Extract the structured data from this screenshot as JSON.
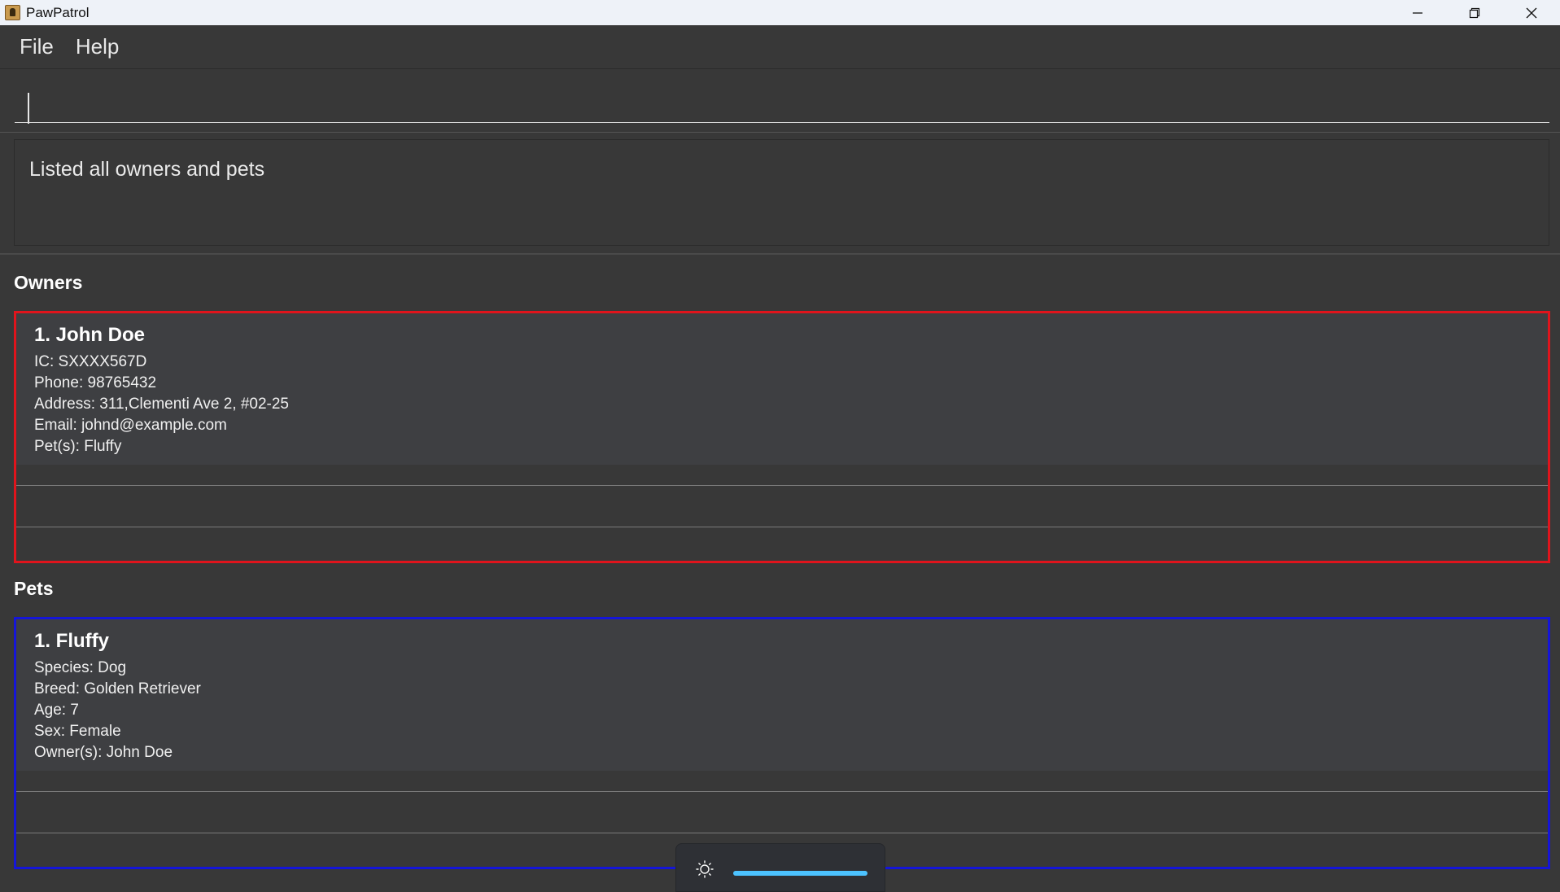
{
  "window": {
    "title": "PawPatrol",
    "controls": {
      "minimize": "–",
      "restore": "❐",
      "close": "✕"
    }
  },
  "menu": {
    "file": "File",
    "help": "Help"
  },
  "command": {
    "value": ""
  },
  "result": {
    "message": "Listed all owners and pets"
  },
  "owners": {
    "title": "Owners",
    "items": [
      {
        "name": "1. John Doe",
        "ic": "IC: SXXXX567D",
        "phone": "Phone: 98765432",
        "address": "Address: 311,Clementi Ave 2, #02-25",
        "email": "Email: johnd@example.com",
        "pets": "Pet(s): Fluffy"
      }
    ]
  },
  "pets": {
    "title": "Pets",
    "items": [
      {
        "name": "1. Fluffy",
        "species": "Species: Dog",
        "breed": "Breed: Golden Retriever",
        "age": "Age: 7",
        "sex": "Sex: Female",
        "owners": "Owner(s): John Doe"
      }
    ]
  },
  "osd": {
    "icon": "brightness-icon",
    "level": 1.0,
    "accent": "#4cc2ff"
  },
  "colors": {
    "owners_border": "#e0141c",
    "pets_border": "#1515d8"
  }
}
